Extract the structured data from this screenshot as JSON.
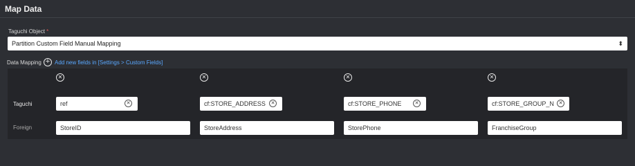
{
  "header": {
    "title": "Map Data"
  },
  "taguchi_object": {
    "label": "Taguchi Object",
    "required_mark": "*",
    "selected": "Partition Custom Field Manual Mapping",
    "caret": "⌃⌄"
  },
  "data_mapping": {
    "label": "Data Mapping",
    "add_link": "Add new fields in [Settings > Custom Fields]",
    "row_labels": {
      "taguchi": "Taguchi",
      "foreign": "Foreign"
    },
    "columns": [
      {
        "taguchi": "ref",
        "foreign": "StoreID"
      },
      {
        "taguchi": "cf:STORE_ADDRESS",
        "foreign": "StoreAddress"
      },
      {
        "taguchi": "cf:STORE_PHONE",
        "foreign": "StorePhone"
      },
      {
        "taguchi": "cf:STORE_GROUP_N",
        "foreign": "FranchiseGroup"
      }
    ]
  },
  "icons": {
    "add": "plus-circle-icon",
    "remove": "x-circle-icon",
    "select_caret": "chevron-up-down-icon"
  }
}
